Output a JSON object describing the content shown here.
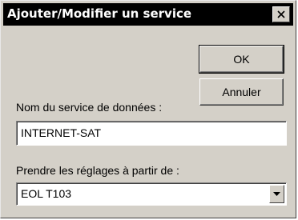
{
  "dialog": {
    "title": "Ajouter/Modifier un service",
    "close_icon": "close-icon"
  },
  "buttons": {
    "ok_label": "OK",
    "cancel_label": "Annuler"
  },
  "service_name": {
    "label": "Nom du service de données :",
    "value": "INTERNET-SAT"
  },
  "settings_source": {
    "label": "Prendre les réglages à partir de :",
    "selected": "EOL T103",
    "dropdown_icon": "chevron-down-icon"
  },
  "colors": {
    "titlebar": "#000000",
    "face": "#d4d0c8"
  }
}
